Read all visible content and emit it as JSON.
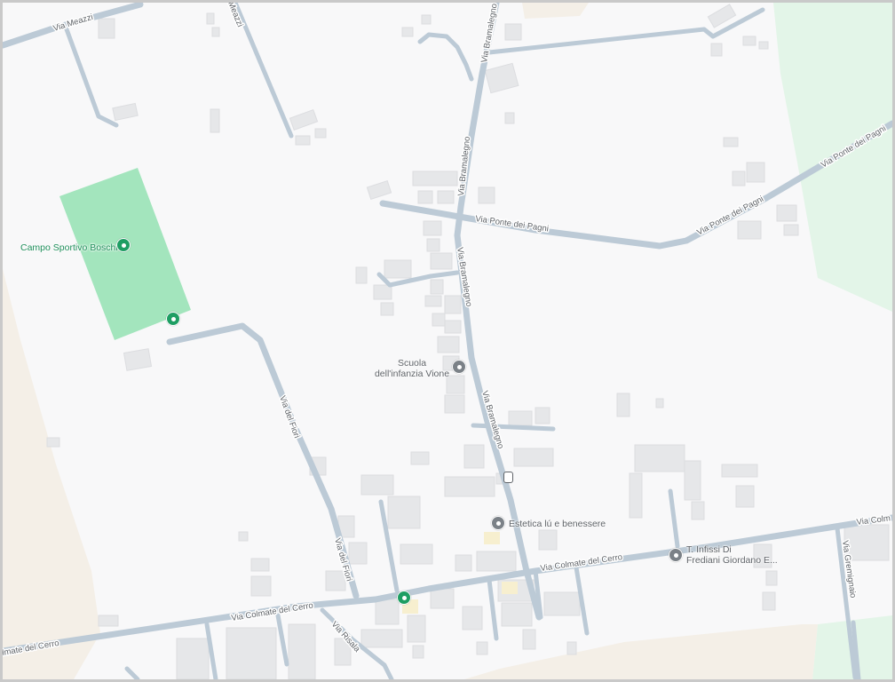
{
  "map": {
    "colors": {
      "background": "#f8f8f9",
      "road": "#bccad6",
      "park": "#a3e5bd",
      "green_area": "#e3f5e8",
      "sand_area": "#f4efe7",
      "building": "#e6e7e9",
      "label_green": "#1e8e5a",
      "label_gray": "#5f6368"
    },
    "roads": {
      "via_meazzi": "Via Meazzi",
      "via_bramalegno": "Via Bramalegno",
      "via_ponte_dei_pagni": "Via Ponte dei Pagni",
      "via_del_fiori": "Via del Fiori",
      "via_colmate_del_cerro": "Via Colmate del Cerro",
      "via_colm": "Via Colm",
      "colmate_del_cerro": "lmate del Cerro",
      "via_risala": "Via Risala",
      "via_gremignaio": "Via Gremignaio",
      "via_meazzi_partial": "Meazzi"
    },
    "places": {
      "campo_sportivo": {
        "name": "Campo Sportivo Boschi",
        "icon": "park-pin-icon"
      },
      "park_pin": {
        "icon": "park-pin-icon"
      },
      "scuola": {
        "name_line1": "Scuola",
        "name_line2": "dell'infanzia Vione",
        "icon": "school-icon"
      },
      "estetica": {
        "name": "Estetica lú e benessere",
        "icon": "location-pin-icon"
      },
      "infissi": {
        "name_line1": "T. Infissi Di",
        "name_line2": "Frediani Giordano E...",
        "icon": "location-pin-icon"
      },
      "bottom_pin": {
        "icon": "park-pin-icon"
      }
    }
  }
}
